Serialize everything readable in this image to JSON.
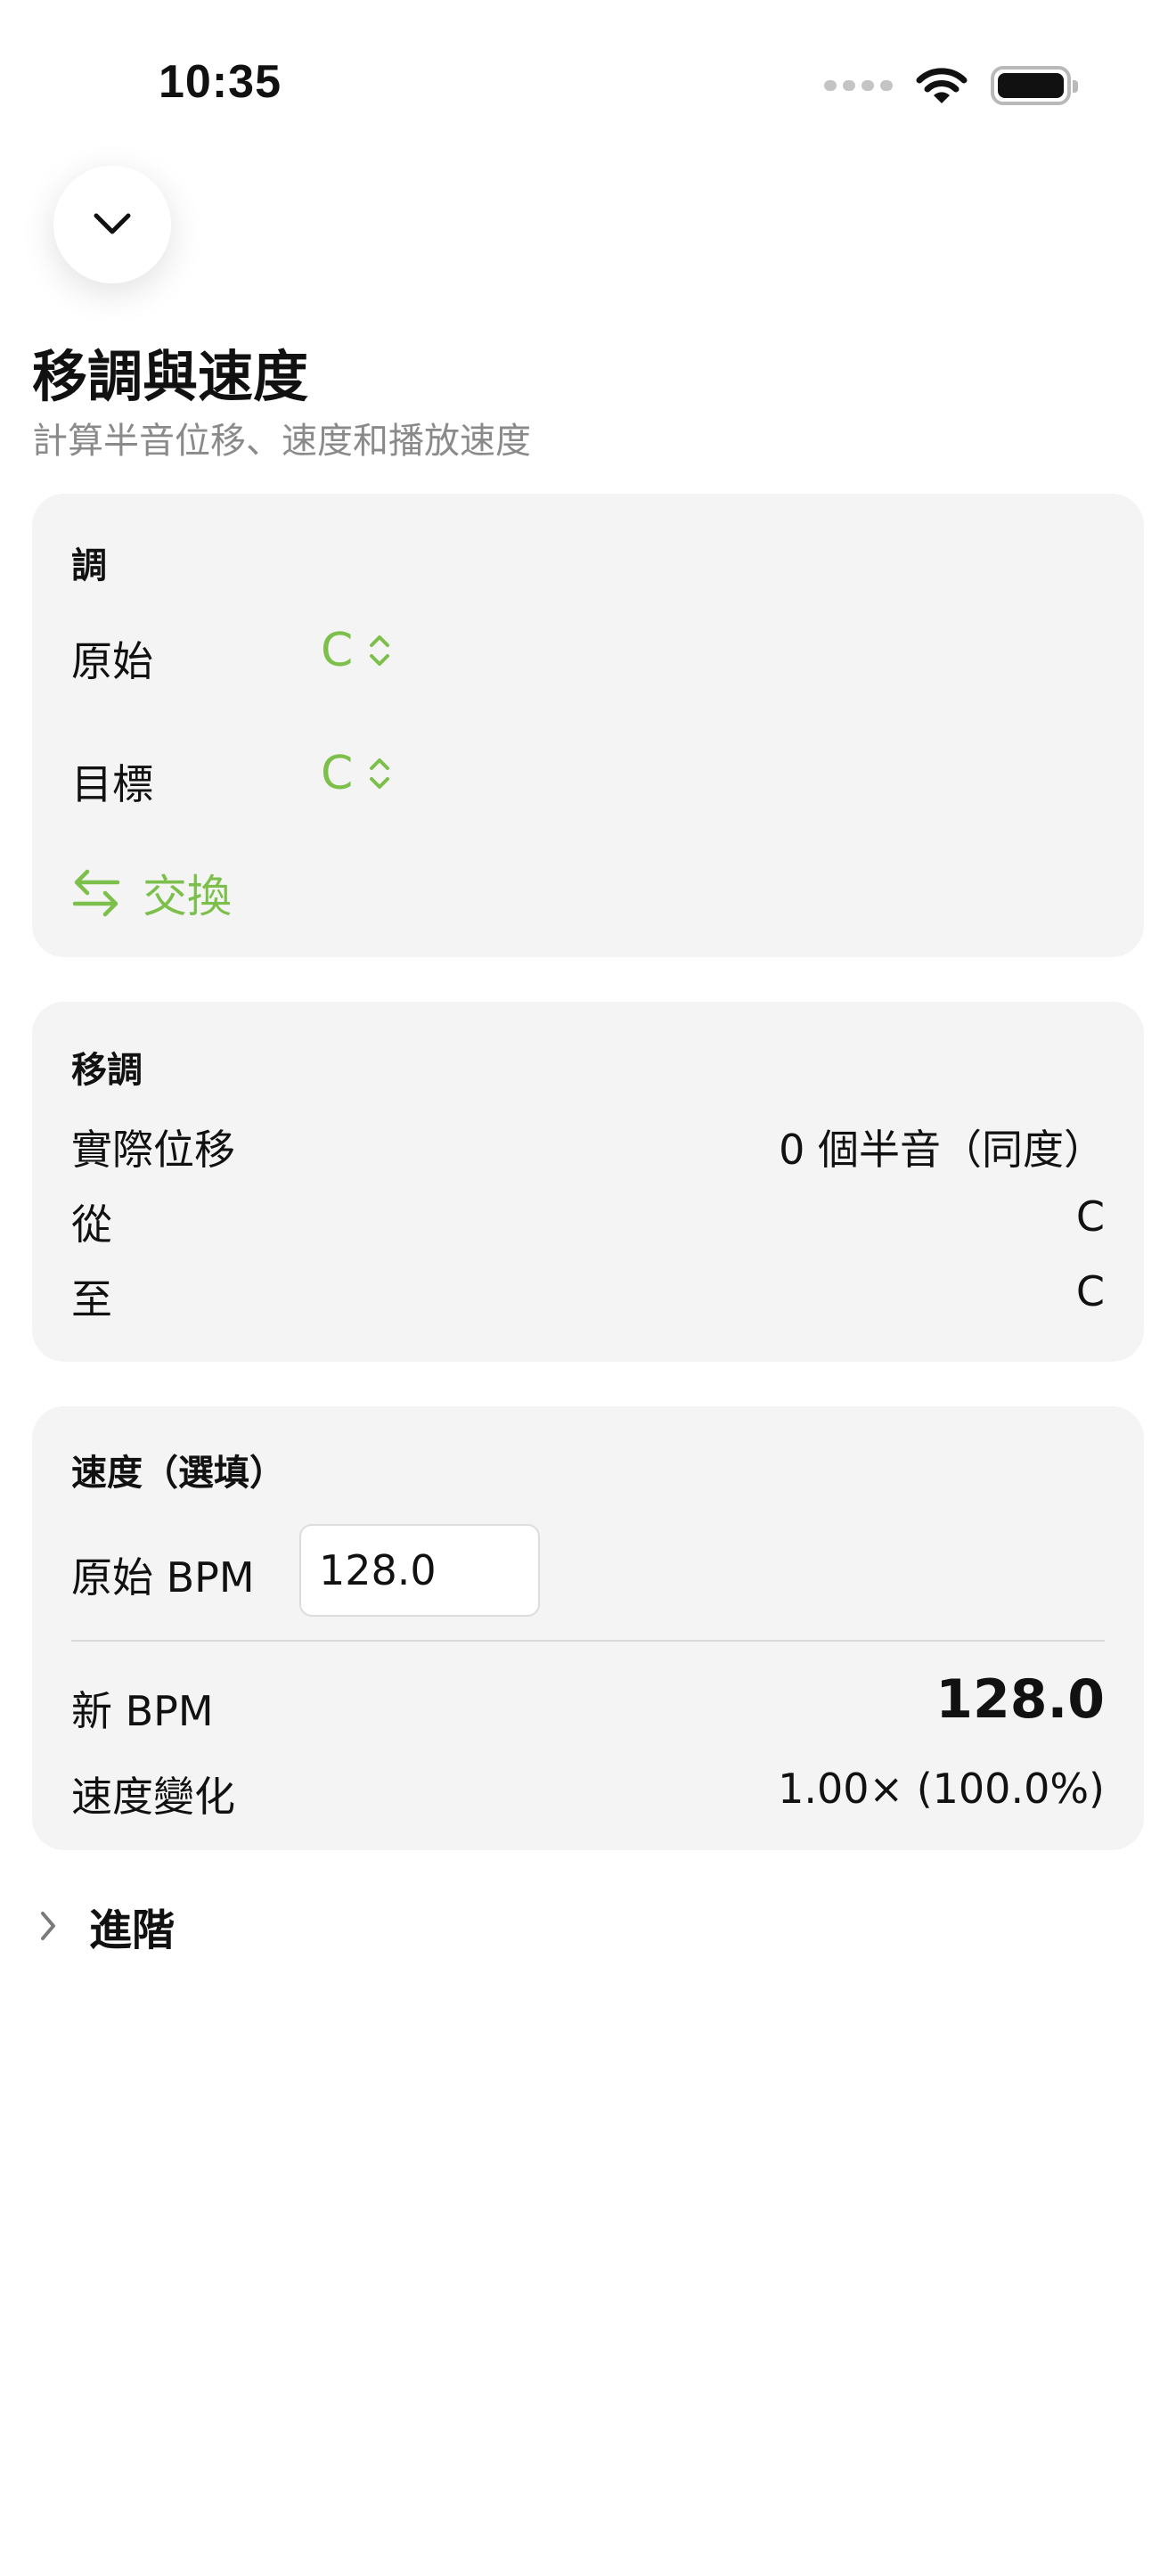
{
  "status_bar": {
    "time": "10:35"
  },
  "header": {
    "title": "移調與速度",
    "subtitle": "計算半音位移、速度和播放速度"
  },
  "key_section": {
    "title": "調",
    "original_label": "原始",
    "original_value": "C",
    "target_label": "目標",
    "target_value": "C",
    "swap_label": "交換"
  },
  "transposition_section": {
    "title": "移調",
    "rows": [
      {
        "label": "實際位移",
        "value": "0 個半音（同度）"
      },
      {
        "label": "從",
        "value": "C"
      },
      {
        "label": "至",
        "value": "C"
      }
    ]
  },
  "tempo_section": {
    "title": "速度（選填）",
    "original_bpm_label": "原始 BPM",
    "original_bpm_value": "128.0",
    "new_bpm_label": "新 BPM",
    "new_bpm_value": "128.0",
    "speed_change_label": "速度變化",
    "speed_change_value": "1.00× (100.0%)"
  },
  "advanced": {
    "label": "進階"
  },
  "colors": {
    "accent": "#7cc04b",
    "card_bg": "#f4f4f4",
    "subtitle": "#8a8a8a"
  },
  "icons": {
    "dismiss": "chevron-down-icon",
    "picker": "chevron-up-down-icon",
    "swap": "swap-arrows-icon",
    "advanced": "chevron-right-icon"
  }
}
